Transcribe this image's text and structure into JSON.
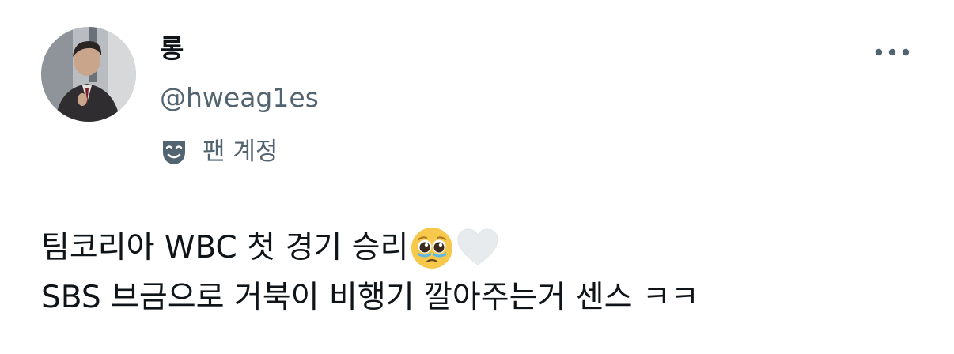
{
  "user": {
    "display_name": "롱",
    "handle": "@hweag1es",
    "avatar_icon": "profile-photo-avatar"
  },
  "badge": {
    "icon": "theater-mask-icon",
    "label": "팬 계정"
  },
  "actions": {
    "more_icon": "more-options-icon"
  },
  "tweet": {
    "line1": "팀코리아 WBC 첫 경기 승리",
    "line1_emojis": [
      "pleading-face-emoji",
      "white-heart-emoji"
    ],
    "line2": "SBS 브금으로 거북이 비행기 깔아주는거 센스 ㅋㅋ"
  },
  "colors": {
    "text_primary": "#0f1419",
    "text_secondary": "#536471",
    "background": "#ffffff"
  }
}
